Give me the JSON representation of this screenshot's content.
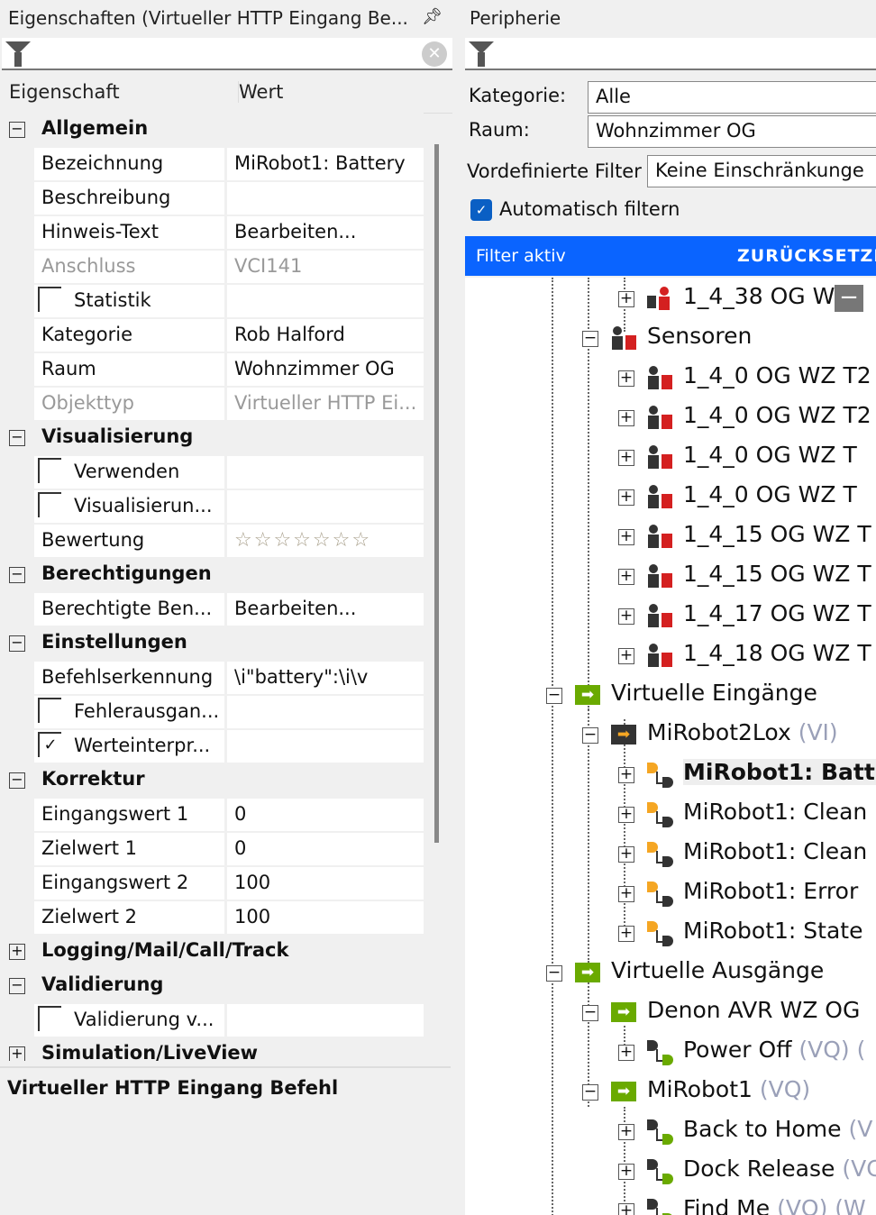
{
  "left": {
    "title": "Eigenschaften (Virtueller HTTP Eingang Be...",
    "pin_icon": "pin-icon",
    "columns": {
      "property": "Eigenschaft",
      "value": "Wert"
    },
    "rows": [
      {
        "type": "group",
        "label": "Allgemein",
        "expanded": true
      },
      {
        "type": "item",
        "label": "Bezeichnung",
        "value": "MiRobot1: Battery"
      },
      {
        "type": "item",
        "label": "Beschreibung",
        "value": ""
      },
      {
        "type": "item",
        "label": "Hinweis-Text",
        "value": "Bearbeiten..."
      },
      {
        "type": "item",
        "label": "Anschluss",
        "value": "VCI141",
        "disabled": true
      },
      {
        "type": "item",
        "label": "Statistik",
        "checkbox": false,
        "value": ""
      },
      {
        "type": "item",
        "label": "Kategorie",
        "value": "Rob Halford"
      },
      {
        "type": "item",
        "label": "Raum",
        "value": "Wohnzimmer OG"
      },
      {
        "type": "item",
        "label": "Objekttyp",
        "value": "Virtueller HTTP Ei...",
        "disabled": true
      },
      {
        "type": "group",
        "label": "Visualisierung",
        "expanded": true
      },
      {
        "type": "item",
        "label": "Verwenden",
        "checkbox": false,
        "value": ""
      },
      {
        "type": "item",
        "label": "Visualisierun...",
        "checkbox": false,
        "value": ""
      },
      {
        "type": "item",
        "label": "Bewertung",
        "value": "☆☆☆☆☆☆☆",
        "rating": 0
      },
      {
        "type": "group",
        "label": "Berechtigungen",
        "expanded": true
      },
      {
        "type": "item",
        "label": "Berechtigte Ben...",
        "value": "Bearbeiten..."
      },
      {
        "type": "group",
        "label": "Einstellungen",
        "expanded": true
      },
      {
        "type": "item",
        "label": "Befehlserkennung",
        "value": "\\i\"battery\":\\i\\v"
      },
      {
        "type": "item",
        "label": "Fehlerausgan...",
        "checkbox": false,
        "value": ""
      },
      {
        "type": "item",
        "label": "Werteinterpr...",
        "checkbox": true,
        "value": ""
      },
      {
        "type": "group",
        "label": "Korrektur",
        "expanded": true
      },
      {
        "type": "item",
        "label": "Eingangswert 1",
        "value": "0"
      },
      {
        "type": "item",
        "label": "Zielwert 1",
        "value": "0"
      },
      {
        "type": "item",
        "label": "Eingangswert 2",
        "value": "100"
      },
      {
        "type": "item",
        "label": "Zielwert 2",
        "value": "100"
      },
      {
        "type": "group",
        "label": "Logging/Mail/Call/Track",
        "expanded": false
      },
      {
        "type": "group",
        "label": "Validierung",
        "expanded": true
      },
      {
        "type": "item",
        "label": "Validierung v...",
        "checkbox": false,
        "value": ""
      },
      {
        "type": "group",
        "label": "Simulation/LiveView",
        "expanded": false
      }
    ],
    "description": "Virtueller HTTP Eingang Befehl"
  },
  "right": {
    "title": "Peripherie",
    "kategorie_label": "Kategorie:",
    "kategorie_value": "Alle",
    "raum_label": "Raum:",
    "raum_value": "Wohnzimmer OG",
    "filter_label": "Vordefinierte Filter",
    "filter_value": "Keine Einschränkunge",
    "auto_filter_label": "Automatisch filtern",
    "auto_filter_checked": true,
    "banner_text": "Filter aktiv",
    "reset_label": "ZURÜCKSETZE",
    "colors": {
      "banner": "#0a64ff",
      "green": "#6aaa00",
      "orange": "#f5a623",
      "red": "#d42020"
    },
    "tree": [
      {
        "level": 2,
        "exp": "+",
        "icon": "actor",
        "name": "1_4_38 OG W",
        "suffix": ""
      },
      {
        "level": 1,
        "exp": "-",
        "icon": "sensor",
        "name": "Sensoren",
        "suffix": ""
      },
      {
        "level": 2,
        "exp": "+",
        "icon": "sensor",
        "name": "1_4_0 OG WZ T2",
        "suffix": ""
      },
      {
        "level": 2,
        "exp": "+",
        "icon": "sensor",
        "name": "1_4_0 OG WZ T2",
        "suffix": ""
      },
      {
        "level": 2,
        "exp": "+",
        "icon": "sensor",
        "name": "1_4_0 OG WZ T",
        "suffix": ""
      },
      {
        "level": 2,
        "exp": "+",
        "icon": "sensor",
        "name": "1_4_0 OG WZ T",
        "suffix": ""
      },
      {
        "level": 2,
        "exp": "+",
        "icon": "sensor",
        "name": "1_4_15 OG WZ T",
        "suffix": ""
      },
      {
        "level": 2,
        "exp": "+",
        "icon": "sensor",
        "name": "1_4_15 OG WZ T",
        "suffix": ""
      },
      {
        "level": 2,
        "exp": "+",
        "icon": "sensor",
        "name": "1_4_17 OG WZ T",
        "suffix": ""
      },
      {
        "level": 2,
        "exp": "+",
        "icon": "sensor",
        "name": "1_4_18 OG WZ T",
        "suffix": ""
      },
      {
        "level": 0,
        "exp": "-",
        "icon": "vin-group",
        "name": "Virtuelle Eingänge",
        "suffix": ""
      },
      {
        "level": 1,
        "exp": "-",
        "icon": "vin",
        "name": "MiRobot2Lox",
        "suffix": " (VI)"
      },
      {
        "level": 2,
        "exp": "+",
        "icon": "vin-cmd",
        "name": "MiRobot1: Batt",
        "suffix": "",
        "selected": true
      },
      {
        "level": 2,
        "exp": "+",
        "icon": "vin-cmd",
        "name": "MiRobot1: Clean",
        "suffix": ""
      },
      {
        "level": 2,
        "exp": "+",
        "icon": "vin-cmd",
        "name": "MiRobot1: Clean",
        "suffix": ""
      },
      {
        "level": 2,
        "exp": "+",
        "icon": "vin-cmd",
        "name": "MiRobot1: Error",
        "suffix": ""
      },
      {
        "level": 2,
        "exp": "+",
        "icon": "vin-cmd",
        "name": "MiRobot1: State",
        "suffix": ""
      },
      {
        "level": 0,
        "exp": "-",
        "icon": "vout-group",
        "name": "Virtuelle Ausgänge",
        "suffix": ""
      },
      {
        "level": 1,
        "exp": "-",
        "icon": "vout",
        "name": "Denon AVR WZ OG",
        "suffix": ""
      },
      {
        "level": 2,
        "exp": "+",
        "icon": "vout-cmd",
        "name": "Power Off",
        "suffix": " (VQ) ("
      },
      {
        "level": 1,
        "exp": "-",
        "icon": "vout",
        "name": "MiRobot1",
        "suffix": " (VQ)"
      },
      {
        "level": 2,
        "exp": "+",
        "icon": "vout-cmd",
        "name": "Back to Home",
        "suffix": " (V"
      },
      {
        "level": 2,
        "exp": "+",
        "icon": "vout-cmd",
        "name": "Dock Release",
        "suffix": " (VC"
      },
      {
        "level": 2,
        "exp": "+",
        "icon": "vout-cmd",
        "name": "Find Me",
        "suffix": " (VQ) (W"
      }
    ]
  }
}
